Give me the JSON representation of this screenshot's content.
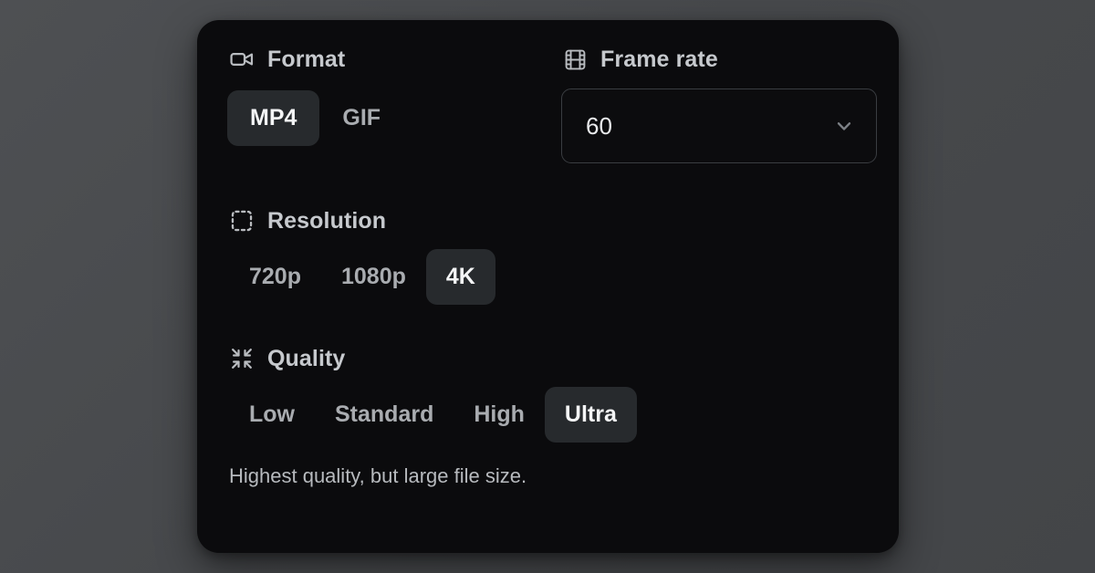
{
  "panel": {
    "sections": [
      {
        "key": "format",
        "icon": "video-camera-icon",
        "title": "Format",
        "options": [
          {
            "label": "MP4",
            "selected": true
          },
          {
            "label": "GIF",
            "selected": false
          }
        ]
      },
      {
        "key": "frame_rate",
        "icon": "film-strip-icon",
        "title": "Frame rate",
        "select": {
          "value": "60",
          "chevron": "chevron-down-icon"
        }
      },
      {
        "key": "resolution",
        "icon": "crop-selection-icon",
        "title": "Resolution",
        "options": [
          {
            "label": "720p",
            "selected": false
          },
          {
            "label": "1080p",
            "selected": false
          },
          {
            "label": "4K",
            "selected": true
          }
        ]
      },
      {
        "key": "quality",
        "icon": "minimize-arrows-icon",
        "title": "Quality",
        "options": [
          {
            "label": "Low",
            "selected": false
          },
          {
            "label": "Standard",
            "selected": false
          },
          {
            "label": "High",
            "selected": false
          },
          {
            "label": "Ultra",
            "selected": true
          }
        ]
      }
    ],
    "hint": "Highest quality, but large file size."
  },
  "colors": {
    "page_background": "#484a4d",
    "panel_background": "#0b0b0d",
    "selected_pill": "#272a2d",
    "selected_text": "#f4f5f6",
    "muted_text": "#a9acb0",
    "heading_text": "#c6c9cd",
    "border": "#3a3d41"
  }
}
